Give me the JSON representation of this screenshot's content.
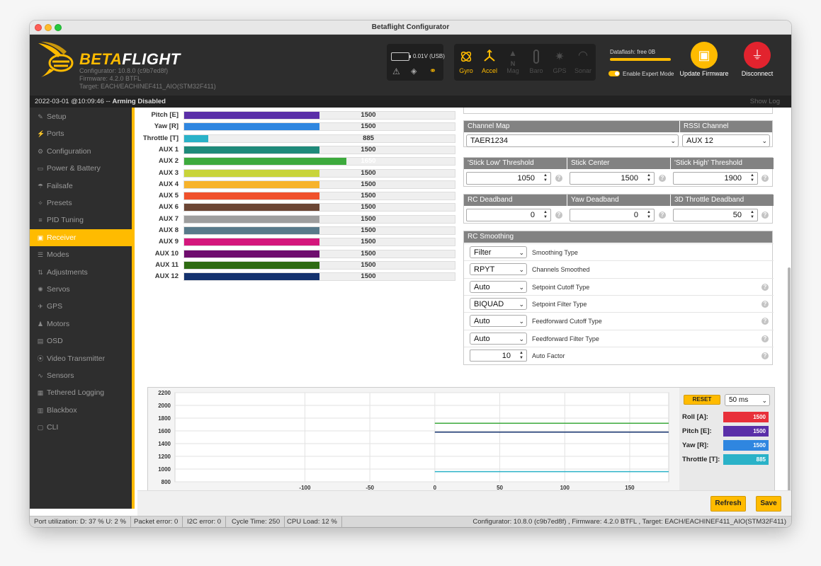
{
  "window": {
    "title": "Betaflight Configurator"
  },
  "header": {
    "logo_prefix": "BETA",
    "logo_suffix": "FLIGHT",
    "configurator": "Configurator: 10.8.0 (c9b7ed8f)",
    "firmware": "Firmware: 4.2.0 BTFL",
    "target": "Target: EACH/EACHINEF411_AIO(STM32F411)",
    "battery": "0.01V (USB)",
    "sensors": [
      "Gyro",
      "Accel",
      "Mag",
      "Baro",
      "GPS",
      "Sonar"
    ],
    "dataflash": "Dataflash: free 0B",
    "expert_mode": "Enable Expert Mode",
    "update_firmware": "Update Firmware",
    "disconnect": "Disconnect"
  },
  "status": {
    "left": "2022-03-01 @10:09:46 -- ",
    "armed": "Arming Disabled",
    "show_log": "Show Log"
  },
  "nav": [
    {
      "label": "Setup",
      "icon": "wrench-icon",
      "glyph": "✎"
    },
    {
      "label": "Ports",
      "icon": "plug-icon",
      "glyph": "⚡"
    },
    {
      "label": "Configuration",
      "icon": "gear-icon",
      "glyph": "⚙"
    },
    {
      "label": "Power & Battery",
      "icon": "battery-icon",
      "glyph": "▭"
    },
    {
      "label": "Failsafe",
      "icon": "parachute-icon",
      "glyph": "☂"
    },
    {
      "label": "Presets",
      "icon": "magic-icon",
      "glyph": "✧"
    },
    {
      "label": "PID Tuning",
      "icon": "sliders-icon",
      "glyph": "≡"
    },
    {
      "label": "Receiver",
      "icon": "receiver-icon",
      "glyph": "▣"
    },
    {
      "label": "Modes",
      "icon": "modes-icon",
      "glyph": "☰"
    },
    {
      "label": "Adjustments",
      "icon": "adjustments-icon",
      "glyph": "⇅"
    },
    {
      "label": "Servos",
      "icon": "servo-icon",
      "glyph": "✺"
    },
    {
      "label": "GPS",
      "icon": "satellite-icon",
      "glyph": "✈"
    },
    {
      "label": "Motors",
      "icon": "motor-icon",
      "glyph": "♟"
    },
    {
      "label": "OSD",
      "icon": "osd-icon",
      "glyph": "▤"
    },
    {
      "label": "Video Transmitter",
      "icon": "vtx-icon",
      "glyph": "⦿"
    },
    {
      "label": "Sensors",
      "icon": "pulse-icon",
      "glyph": "∿"
    },
    {
      "label": "Tethered Logging",
      "icon": "log-icon",
      "glyph": "▦"
    },
    {
      "label": "Blackbox",
      "icon": "blackbox-icon",
      "glyph": "▥"
    },
    {
      "label": "CLI",
      "icon": "terminal-icon",
      "glyph": "▢"
    }
  ],
  "channels": [
    {
      "name": "Pitch [E]",
      "value": 1500,
      "color": "#5a2fa8"
    },
    {
      "name": "Yaw [R]",
      "value": 1500,
      "color": "#2f86e0"
    },
    {
      "name": "Throttle [T]",
      "value": 885,
      "color": "#2ab2c8"
    },
    {
      "name": "AUX 1",
      "value": 1500,
      "color": "#1f8a7a"
    },
    {
      "name": "AUX 2",
      "value": 1650,
      "color": "#3daa3d"
    },
    {
      "name": "AUX 3",
      "value": 1500,
      "color": "#c8d43a"
    },
    {
      "name": "AUX 4",
      "value": 1500,
      "color": "#f7b32b"
    },
    {
      "name": "AUX 5",
      "value": 1500,
      "color": "#f0512c"
    },
    {
      "name": "AUX 6",
      "value": 1500,
      "color": "#6b4634"
    },
    {
      "name": "AUX 7",
      "value": 1500,
      "color": "#9e9e9e"
    },
    {
      "name": "AUX 8",
      "value": 1500,
      "color": "#587a8a"
    },
    {
      "name": "AUX 9",
      "value": 1500,
      "color": "#d4177c"
    },
    {
      "name": "AUX 10",
      "value": 1500,
      "color": "#6f0d6e"
    },
    {
      "name": "AUX 11",
      "value": 1500,
      "color": "#2e6b12"
    },
    {
      "name": "AUX 12",
      "value": 1500,
      "color": "#14326e"
    }
  ],
  "channel_map": {
    "label": "Channel Map",
    "value": "TAER1234"
  },
  "rssi": {
    "label": "RSSI Channel",
    "value": "AUX 12"
  },
  "stick": {
    "low_label": "'Stick Low' Threshold",
    "low": "1050",
    "center_label": "Stick Center",
    "center": "1500",
    "high_label": "'Stick High' Threshold",
    "high": "1900"
  },
  "deadband": {
    "rc_label": "RC Deadband",
    "rc": "0",
    "yaw_label": "Yaw Deadband",
    "yaw": "0",
    "throttle_label": "3D Throttle Deadband",
    "throttle": "50"
  },
  "smoothing": {
    "title": "RC Smoothing",
    "rows": [
      {
        "value": "Filter",
        "label": "Smoothing Type",
        "kind": "select",
        "help": false
      },
      {
        "value": "RPYT",
        "label": "Channels Smoothed",
        "kind": "select",
        "help": false
      },
      {
        "value": "Auto",
        "label": "Setpoint Cutoff Type",
        "kind": "select",
        "help": true
      },
      {
        "value": "BIQUAD",
        "label": "Setpoint Filter Type",
        "kind": "select",
        "help": true
      },
      {
        "value": "Auto",
        "label": "Feedforward Cutoff Type",
        "kind": "select",
        "help": true
      },
      {
        "value": "Auto",
        "label": "Feedforward Filter Type",
        "kind": "select",
        "help": true
      },
      {
        "value": "10",
        "label": "Auto Factor",
        "kind": "number",
        "help": true
      }
    ]
  },
  "graph": {
    "reset": "RESET",
    "interval": "50 ms",
    "legend": [
      {
        "name": "Roll [A]:",
        "value": "1500",
        "color": "#e8303a"
      },
      {
        "name": "Pitch [E]:",
        "value": "1500",
        "color": "#5a2fa8"
      },
      {
        "name": "Yaw [R]:",
        "value": "1500",
        "color": "#2f86e0"
      },
      {
        "name": "Throttle [T]:",
        "value": "885",
        "color": "#2ab2c8"
      }
    ]
  },
  "chart_data": {
    "type": "line",
    "x_ticks": [
      "-100",
      "-50",
      "0",
      "50",
      "100",
      "150"
    ],
    "y_ticks": [
      "2200",
      "2000",
      "1800",
      "1600",
      "1400",
      "1200",
      "1000",
      "800"
    ],
    "xlim": [
      -200,
      180
    ],
    "ylim": [
      800,
      2200
    ],
    "series": [
      {
        "color": "#3daa3d",
        "x": [
          0,
          180
        ],
        "y": [
          1720,
          1720
        ]
      },
      {
        "color": "#14326e",
        "x": [
          0,
          180
        ],
        "y": [
          1580,
          1580
        ]
      },
      {
        "color": "#2ab2c8",
        "x": [
          0,
          180
        ],
        "y": [
          960,
          960
        ]
      }
    ]
  },
  "buttons": {
    "refresh": "Refresh",
    "save": "Save"
  },
  "bottom": {
    "port": "Port utilization: D: 37 % U: 2 %",
    "packet": "Packet error: 0",
    "i2c": "I2C error: 0",
    "cycle": "Cycle Time: 250",
    "cpu": "CPU Load: 12 %",
    "version": "Configurator: 10.8.0 (c9b7ed8f) , Firmware: 4.2.0 BTFL , Target: EACH/EACHINEF411_AIO(STM32F411)"
  }
}
